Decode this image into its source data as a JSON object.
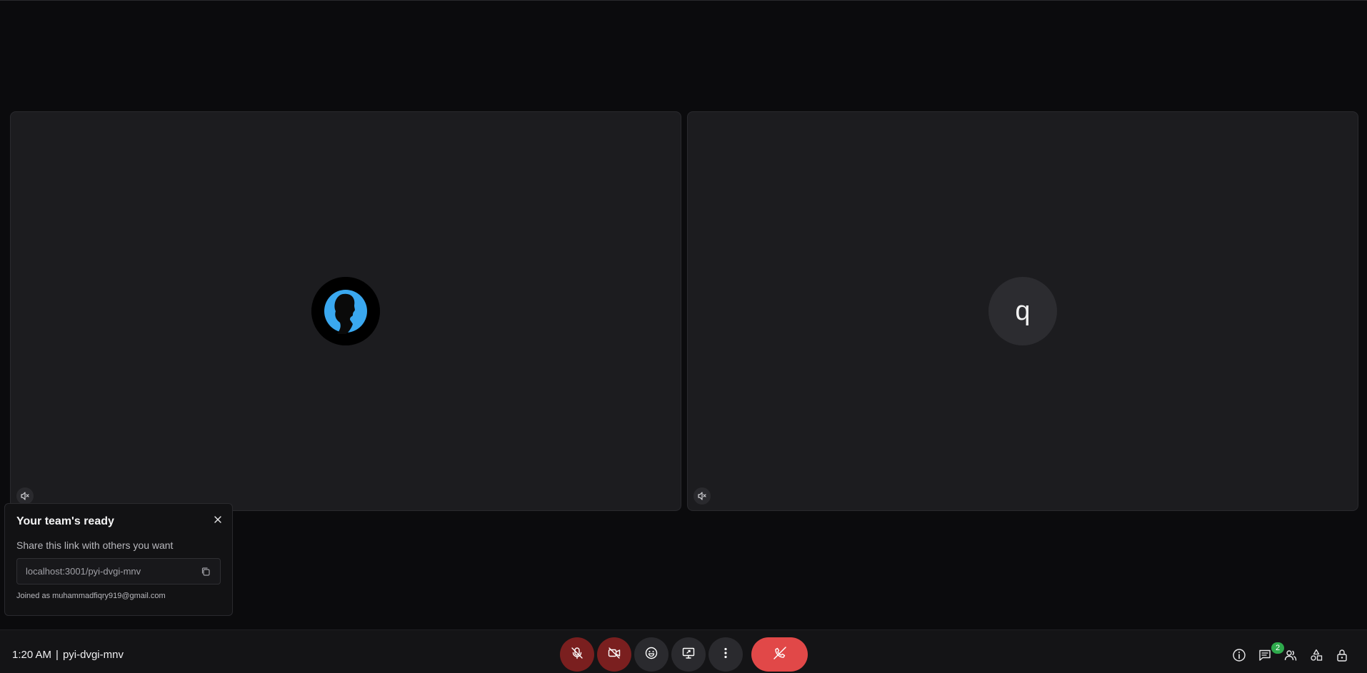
{
  "tiles": [
    {
      "muted_icon": "speaker-muted-icon",
      "avatar": "profile-photo"
    },
    {
      "muted_icon": "speaker-muted-icon",
      "avatar_letter": "q"
    }
  ],
  "popup": {
    "title": "Your team's ready",
    "description": "Share this link with others you want",
    "link": "localhost:3001/pyi-dvgi-mnv",
    "joined_as": "Joined as muhammadfiqry919@gmail.com",
    "close_icon": "close-icon",
    "copy_icon": "copy-icon"
  },
  "bottombar": {
    "time": "1:20 AM",
    "separator": "|",
    "meeting_code": "pyi-dvgi-mnv",
    "controls": [
      "mic-off-icon",
      "camera-off-icon",
      "emoji-icon",
      "present-screen-icon",
      "more-vert-icon",
      "hang-up-icon"
    ],
    "right_icons": [
      "info-icon",
      "chat-icon",
      "people-icon",
      "activities-icon",
      "lock-icon"
    ],
    "participants_count": "2"
  },
  "colors": {
    "background": "#0b0b0d",
    "tile": "#1c1c1f",
    "muted_red": "#7a1f1f",
    "hangup_red": "#e14848",
    "badge_green": "#2eaa4c",
    "avatar_blue": "#3aa8f0"
  }
}
